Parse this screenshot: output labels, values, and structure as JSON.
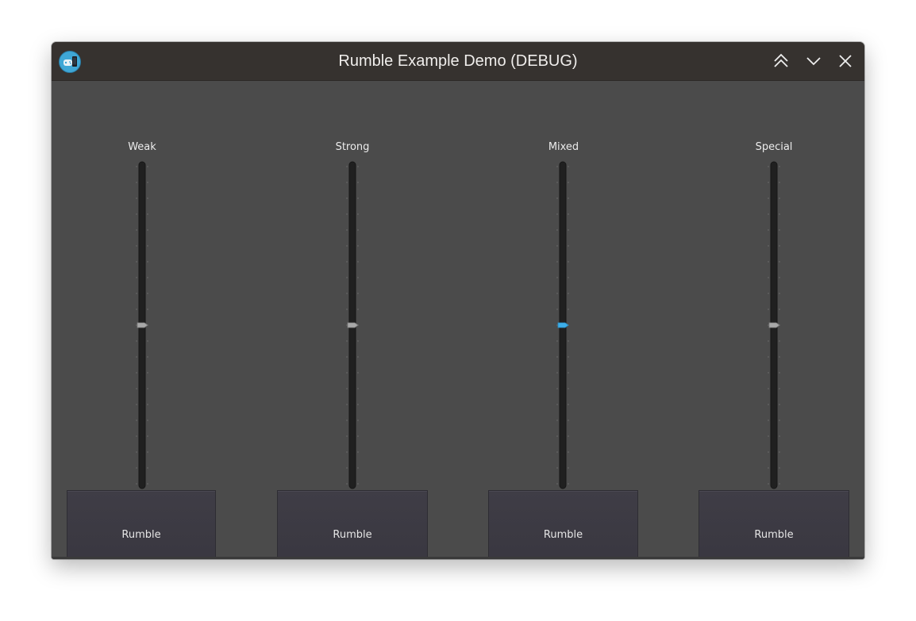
{
  "window": {
    "title": "Rumble Example Demo (DEBUG)",
    "app_icon": "gamepad-icon",
    "controls": {
      "maximize": "double-chevron-up-icon",
      "minimize": "chevron-down-icon",
      "close": "close-icon"
    }
  },
  "colors": {
    "titlebar": "#36322f",
    "background": "#4b4b4b",
    "groove": "#202020",
    "handle": "#a8a8a8",
    "handle_focused": "#3daee9",
    "button": "#3c3a43"
  },
  "sliders": [
    {
      "label": "Weak",
      "value": 0.5,
      "focused": false,
      "button_label": "Rumble"
    },
    {
      "label": "Strong",
      "value": 0.5,
      "focused": false,
      "button_label": "Rumble"
    },
    {
      "label": "Mixed",
      "value": 0.5,
      "focused": true,
      "button_label": "Rumble"
    },
    {
      "label": "Special",
      "value": 0.5,
      "focused": false,
      "button_label": "Rumble"
    }
  ]
}
